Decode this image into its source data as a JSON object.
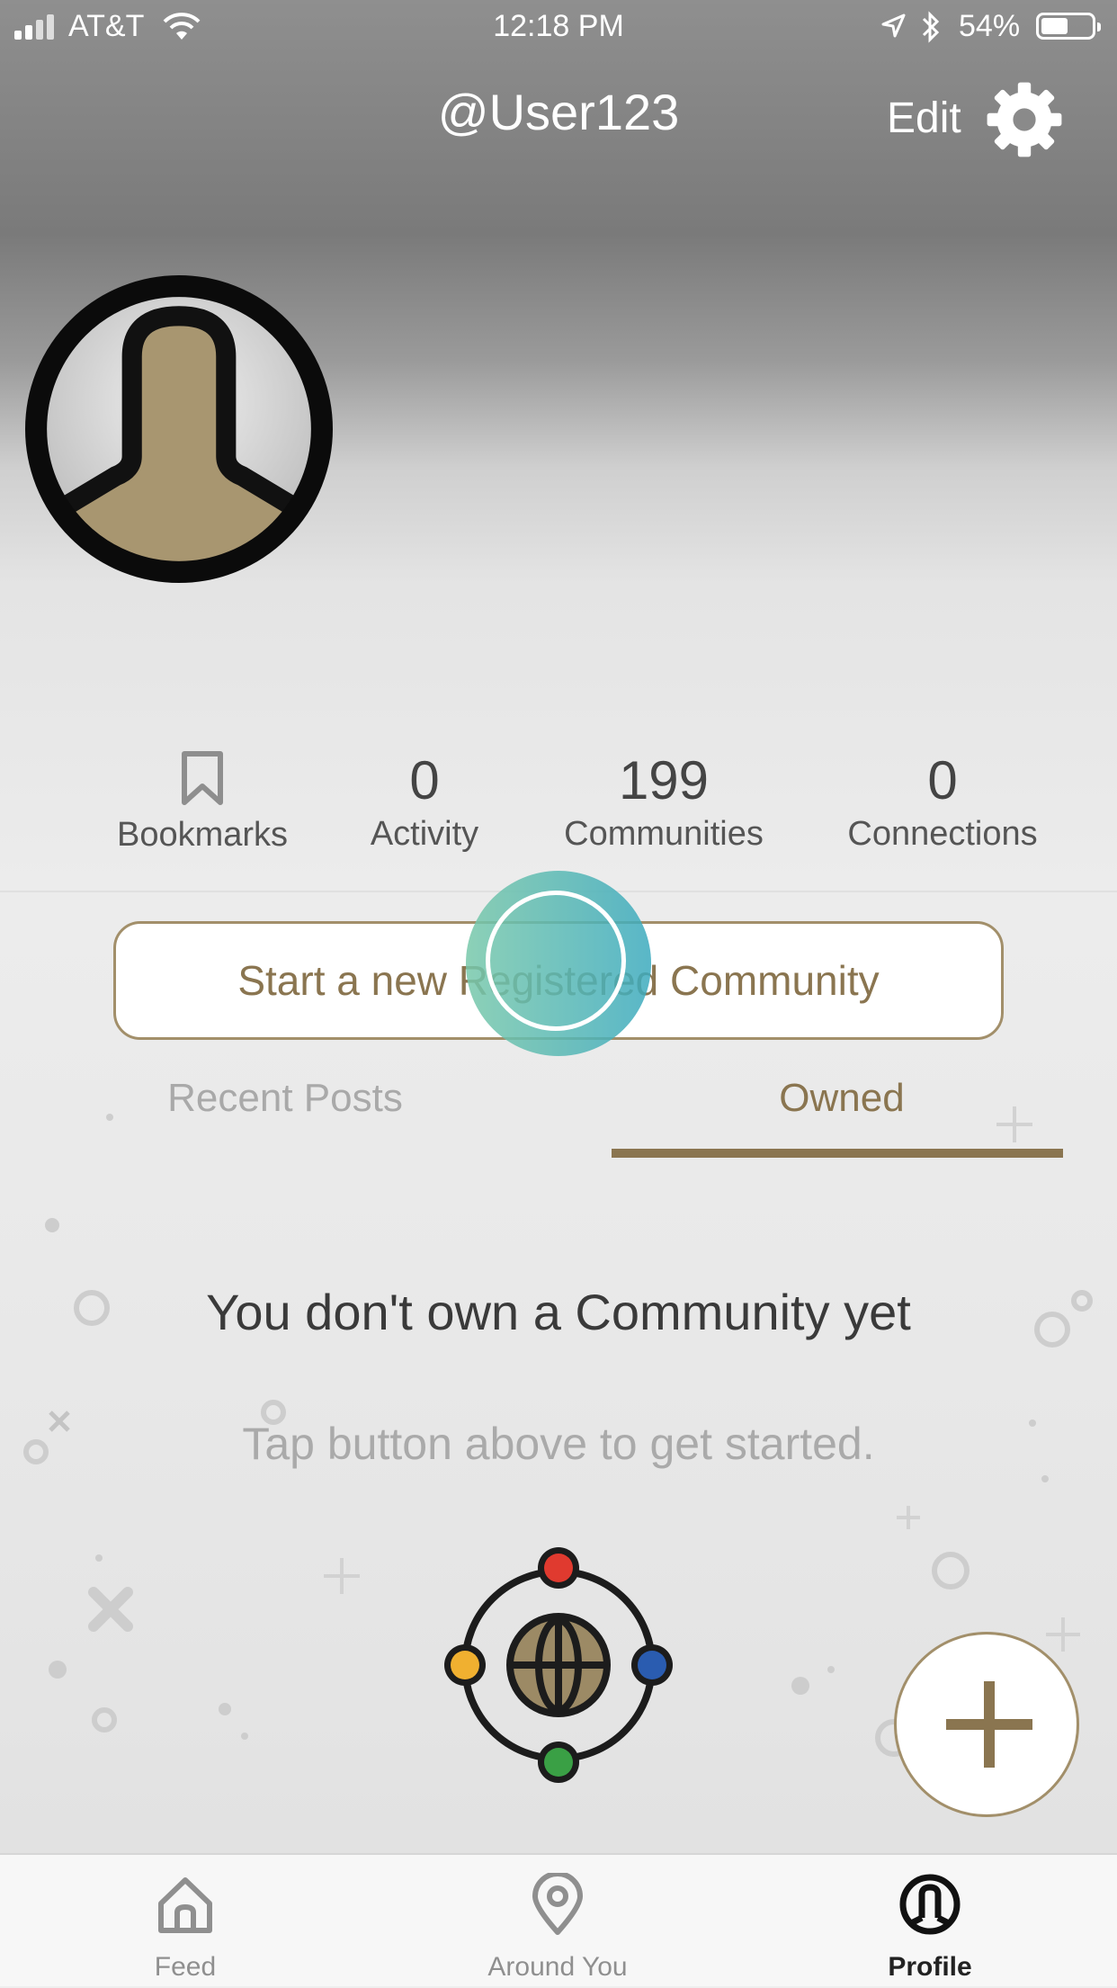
{
  "status_bar": {
    "carrier": "AT&T",
    "time": "12:18 PM",
    "battery": "54%",
    "battery_level": 0.54
  },
  "header": {
    "username": "@User123",
    "edit_label": "Edit"
  },
  "stats": {
    "bookmarks_label": "Bookmarks",
    "activity_value": "0",
    "activity_label": "Activity",
    "communities_value": "199",
    "communities_label": "Communities",
    "connections_value": "0",
    "connections_label": "Connections"
  },
  "start_button_label": "Start a new Registered Community",
  "tabs": {
    "recent_label": "Recent Posts",
    "owned_label": "Owned",
    "active": "Owned"
  },
  "empty_state": {
    "title": "You don't own a Community yet",
    "subtitle": "Tap button above to get started."
  },
  "tab_bar": {
    "items": [
      {
        "label": "Feed",
        "icon": "home-icon"
      },
      {
        "label": "Around You",
        "icon": "location-pin-icon"
      },
      {
        "label": "Profile",
        "icon": "profile-icon"
      }
    ],
    "active": "Profile"
  },
  "colors": {
    "accent": "#8a7550",
    "accent_border": "#a28f6a",
    "globe_dots": [
      "#e03a2f",
      "#f0b030",
      "#2a5cb0",
      "#3aa045"
    ]
  }
}
